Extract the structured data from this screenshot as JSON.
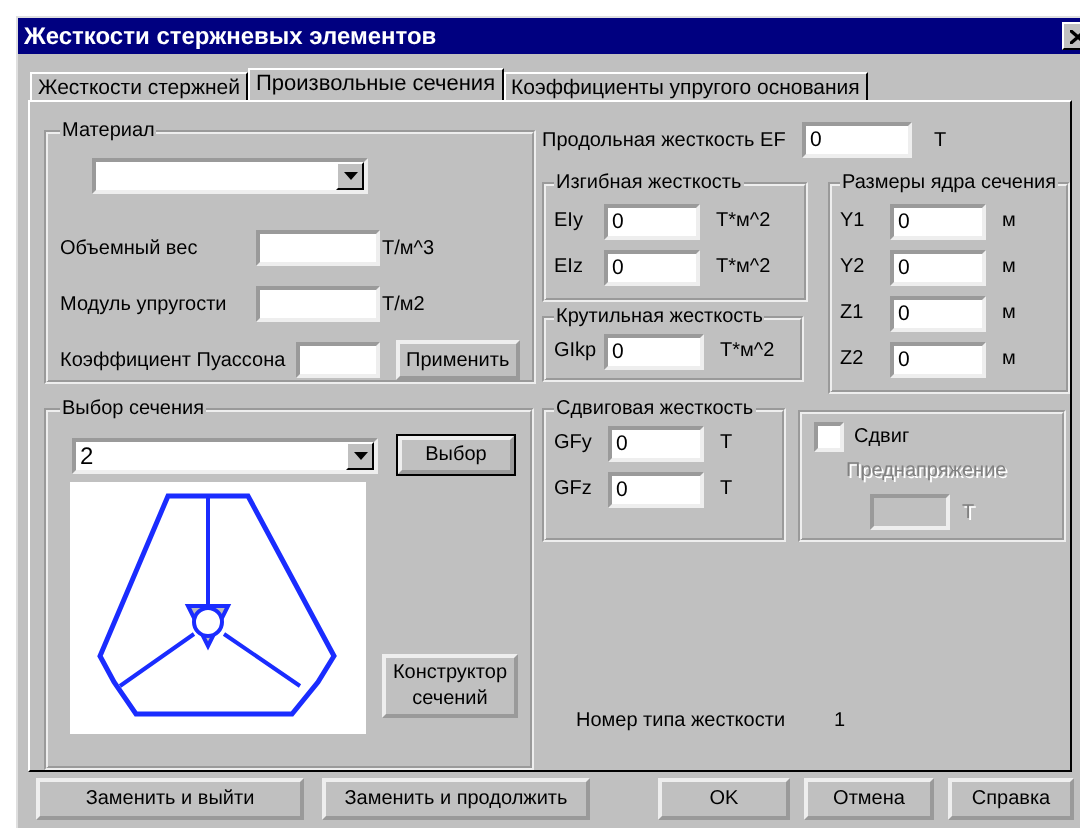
{
  "window": {
    "title": "Жесткости стержневых элементов"
  },
  "tabs": [
    {
      "label": "Жесткости стержней",
      "selected": false
    },
    {
      "label": "Произвольные сечения",
      "selected": true
    },
    {
      "label": "Коэффициенты упругого основания",
      "selected": false
    }
  ],
  "material": {
    "title": "Материал",
    "rows": [
      {
        "label": "Объемный вес",
        "unit": "Т/м^3"
      },
      {
        "label": "Модуль упругости",
        "unit": "Т/м2"
      },
      {
        "label": "Коэффициент Пуассона"
      }
    ],
    "apply_button": "Применить"
  },
  "section": {
    "title": "Выбор сечения",
    "value": "2",
    "select_button": "Выбор",
    "constructor_button": "Конструктор сечений"
  },
  "axial": {
    "label": "Продольная жесткость EF",
    "value": "0",
    "unit": "Т"
  },
  "bending": {
    "title": "Изгибная жесткость",
    "rows": [
      {
        "label": "EIy",
        "value": "0",
        "unit": "Т*м^2"
      },
      {
        "label": "EIz",
        "value": "0",
        "unit": "Т*м^2"
      }
    ]
  },
  "torsion": {
    "title": "Крутильная жесткость",
    "rows": [
      {
        "label": "GIkp",
        "value": "0",
        "unit": "Т*м^2"
      }
    ]
  },
  "core": {
    "title": "Размеры ядра сечения",
    "rows": [
      {
        "label": "Y1",
        "value": "0",
        "unit": "м"
      },
      {
        "label": "Y2",
        "value": "0",
        "unit": "м"
      },
      {
        "label": "Z1",
        "value": "0",
        "unit": "м"
      },
      {
        "label": "Z2",
        "value": "0",
        "unit": "м"
      }
    ]
  },
  "shear": {
    "title": "Сдвиговая жесткость",
    "rows": [
      {
        "label": "GFy",
        "value": "0",
        "unit": "Т"
      },
      {
        "label": "GFz",
        "value": "0",
        "unit": "Т"
      }
    ]
  },
  "shift": {
    "label": "Сдвиг",
    "checked": false,
    "prestress_label": "Преднапряжение",
    "unit": "Т",
    "disabled": true
  },
  "stiffness_type": {
    "label": "Номер типа жесткости",
    "value": "1"
  },
  "buttons": [
    {
      "label": "Заменить и выйти"
    },
    {
      "label": "Заменить и продолжить"
    },
    {
      "label": "OK"
    },
    {
      "label": "Отмена"
    },
    {
      "label": "Справка"
    }
  ]
}
